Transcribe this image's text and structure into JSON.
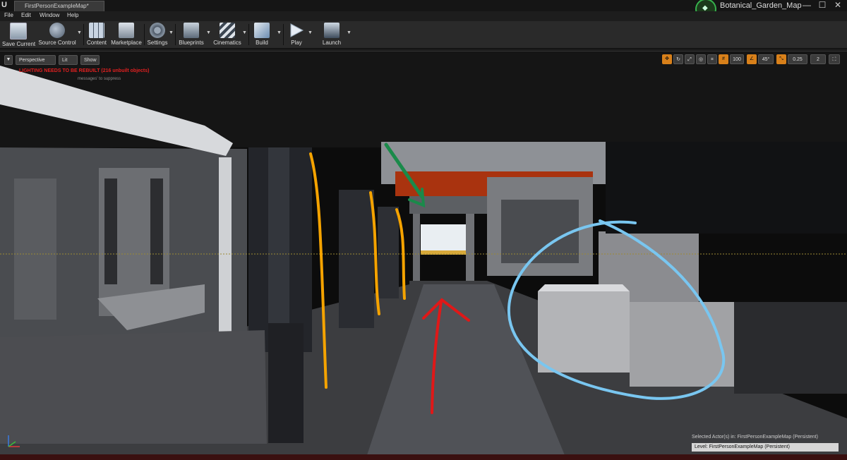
{
  "window": {
    "logo": "U",
    "tab": "FirstPersonExampleMap*",
    "project_name": "Botanical_Garden_Map",
    "minimize": "—",
    "maximize": "☐",
    "close": "✕"
  },
  "menu": [
    "File",
    "Edit",
    "Window",
    "Help"
  ],
  "toolbar": [
    {
      "label": "Save Current",
      "icon": "save-icon"
    },
    {
      "label": "Source Control",
      "icon": "source-control-icon"
    },
    {
      "label": "Content",
      "icon": "content-icon"
    },
    {
      "label": "Marketplace",
      "icon": "marketplace-icon"
    },
    {
      "label": "Settings",
      "icon": "settings-icon"
    },
    {
      "label": "Blueprints",
      "icon": "blueprints-icon"
    },
    {
      "label": "Cinematics",
      "icon": "cinematics-icon"
    },
    {
      "label": "Build",
      "icon": "build-icon"
    },
    {
      "label": "Play",
      "icon": "play-icon"
    },
    {
      "label": "Launch",
      "icon": "launch-icon"
    }
  ],
  "viewport": {
    "view_mode": "Perspective",
    "lighting_mode": "Lit",
    "show_label": "Show",
    "warning": "LIGHTING NEEDS TO BE REBUILT (216 unbuilt objects)",
    "warning_sub": "messages' to suppress",
    "grid_snap": "100",
    "rotation_snap": "45°",
    "scale_snap": "0.25",
    "camera_speed": "2",
    "selected_actor": "Selected Actor(s) in:  FirstPersonExampleMap (Persistent)",
    "level": "Level:  FirstPersonExampleMap (Persistent)"
  },
  "colors": {
    "accent_orange": "#d8801a",
    "warning_red": "#e02020",
    "annotation_orange": "#f5a300",
    "annotation_green": "#1a8a4a",
    "annotation_red": "#e01818",
    "annotation_blue": "#79c6f0"
  }
}
